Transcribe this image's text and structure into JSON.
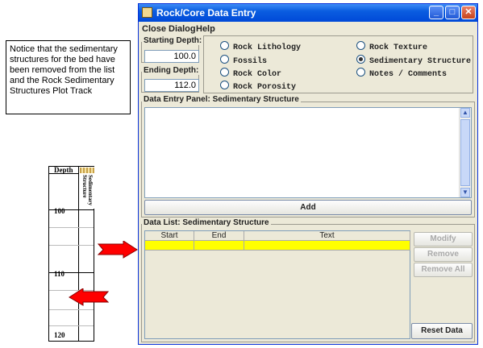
{
  "note": {
    "text": "Notice that the sedimentary structures for the bed have been removed from the list and the Rock Sedimentary Structures Plot Track"
  },
  "track": {
    "depth_label": "Depth",
    "track_name": "Sedimentary Structure",
    "ticks": [
      "100",
      "110",
      "120"
    ]
  },
  "window": {
    "title": "Rock/Core Data Entry",
    "menu": [
      "Close Dialog",
      "Help"
    ],
    "starting_depth_label": "Starting Depth:",
    "starting_depth_value": "100.0",
    "ending_depth_label": "Ending Depth:",
    "ending_depth_value": "112.0",
    "options": [
      {
        "label": "Rock Lithology",
        "selected": false
      },
      {
        "label": "Fossils",
        "selected": false
      },
      {
        "label": "Rock Color",
        "selected": false
      },
      {
        "label": "Rock Porosity",
        "selected": false
      },
      {
        "label": "Rock Texture",
        "selected": false
      },
      {
        "label": "Sedimentary Structure",
        "selected": true
      },
      {
        "label": "Notes / Comments",
        "selected": false
      }
    ],
    "entry_panel_title": "Data Entry Panel: Sedimentary Structure",
    "add_label": "Add",
    "data_list_title": "Data List: Sedimentary Structure",
    "columns": [
      "Start",
      "End",
      "Text"
    ],
    "buttons": {
      "modify": "Modify",
      "remove": "Remove",
      "remove_all": "Remove All",
      "reset": "Reset Data"
    }
  },
  "colors": {
    "title_bar": "#0a5de0",
    "row_highlight": "#ffff00",
    "arrow": "#ff0000"
  }
}
